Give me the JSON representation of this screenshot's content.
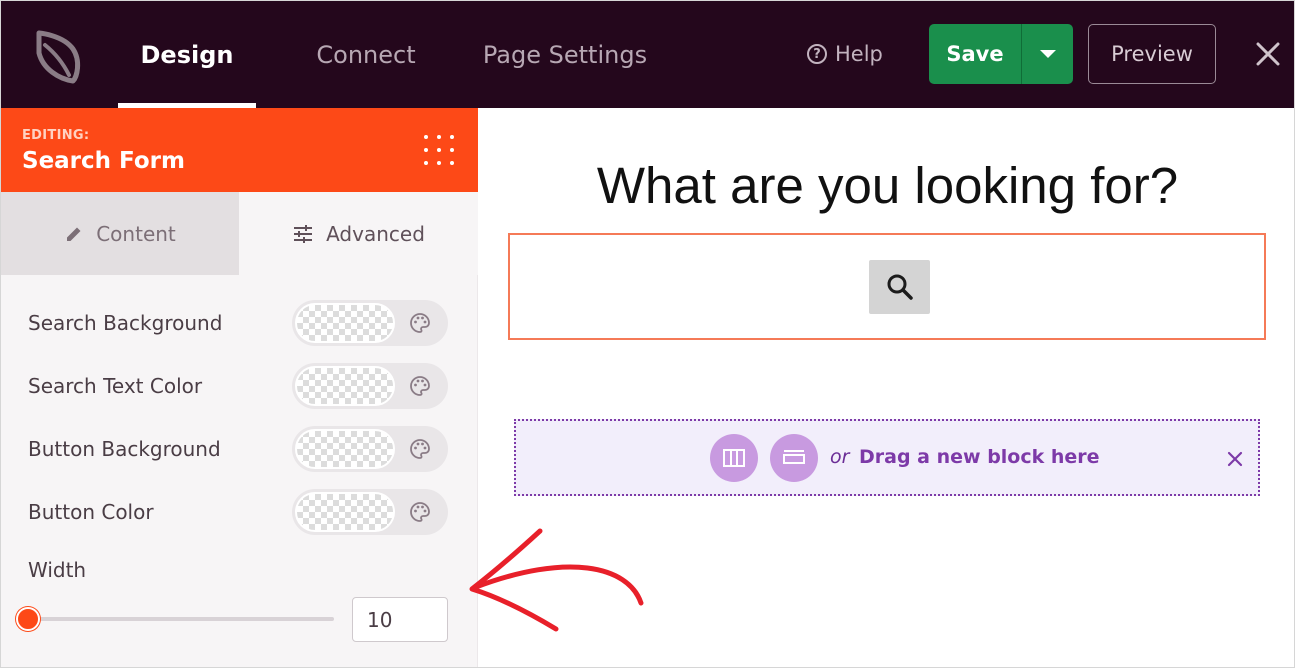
{
  "topbar": {
    "tabs": [
      {
        "label": "Design",
        "active": true
      },
      {
        "label": "Connect",
        "active": false
      },
      {
        "label": "Page Settings",
        "active": false
      }
    ],
    "help_label": "Help",
    "save_label": "Save",
    "preview_label": "Preview",
    "icons": [
      "logo-icon",
      "help-icon",
      "chevron-down-icon",
      "close-icon"
    ]
  },
  "sidebar": {
    "editing_kicker": "EDITING:",
    "editing_title": "Search Form",
    "tabs": [
      {
        "label": "Content",
        "icon": "pencil-icon",
        "active": true
      },
      {
        "label": "Advanced",
        "icon": "sliders-icon",
        "active": false
      }
    ],
    "color_rows": [
      {
        "label": "Search Background"
      },
      {
        "label": "Search Text Color"
      },
      {
        "label": "Button Background"
      },
      {
        "label": "Button Color"
      }
    ],
    "width": {
      "label": "Width",
      "value": "10",
      "slider_fraction": 0
    }
  },
  "canvas": {
    "headline": "What are you looking for?",
    "drop_zone": {
      "or_text": "or",
      "drag_text": "Drag a new block here"
    }
  },
  "colors": {
    "topbar_bg": "#24071c",
    "accent_orange": "#fd4917",
    "save_green": "#1a8f4c",
    "drop_purple": "#7d3aa8",
    "annotation_red": "#e8202a"
  }
}
